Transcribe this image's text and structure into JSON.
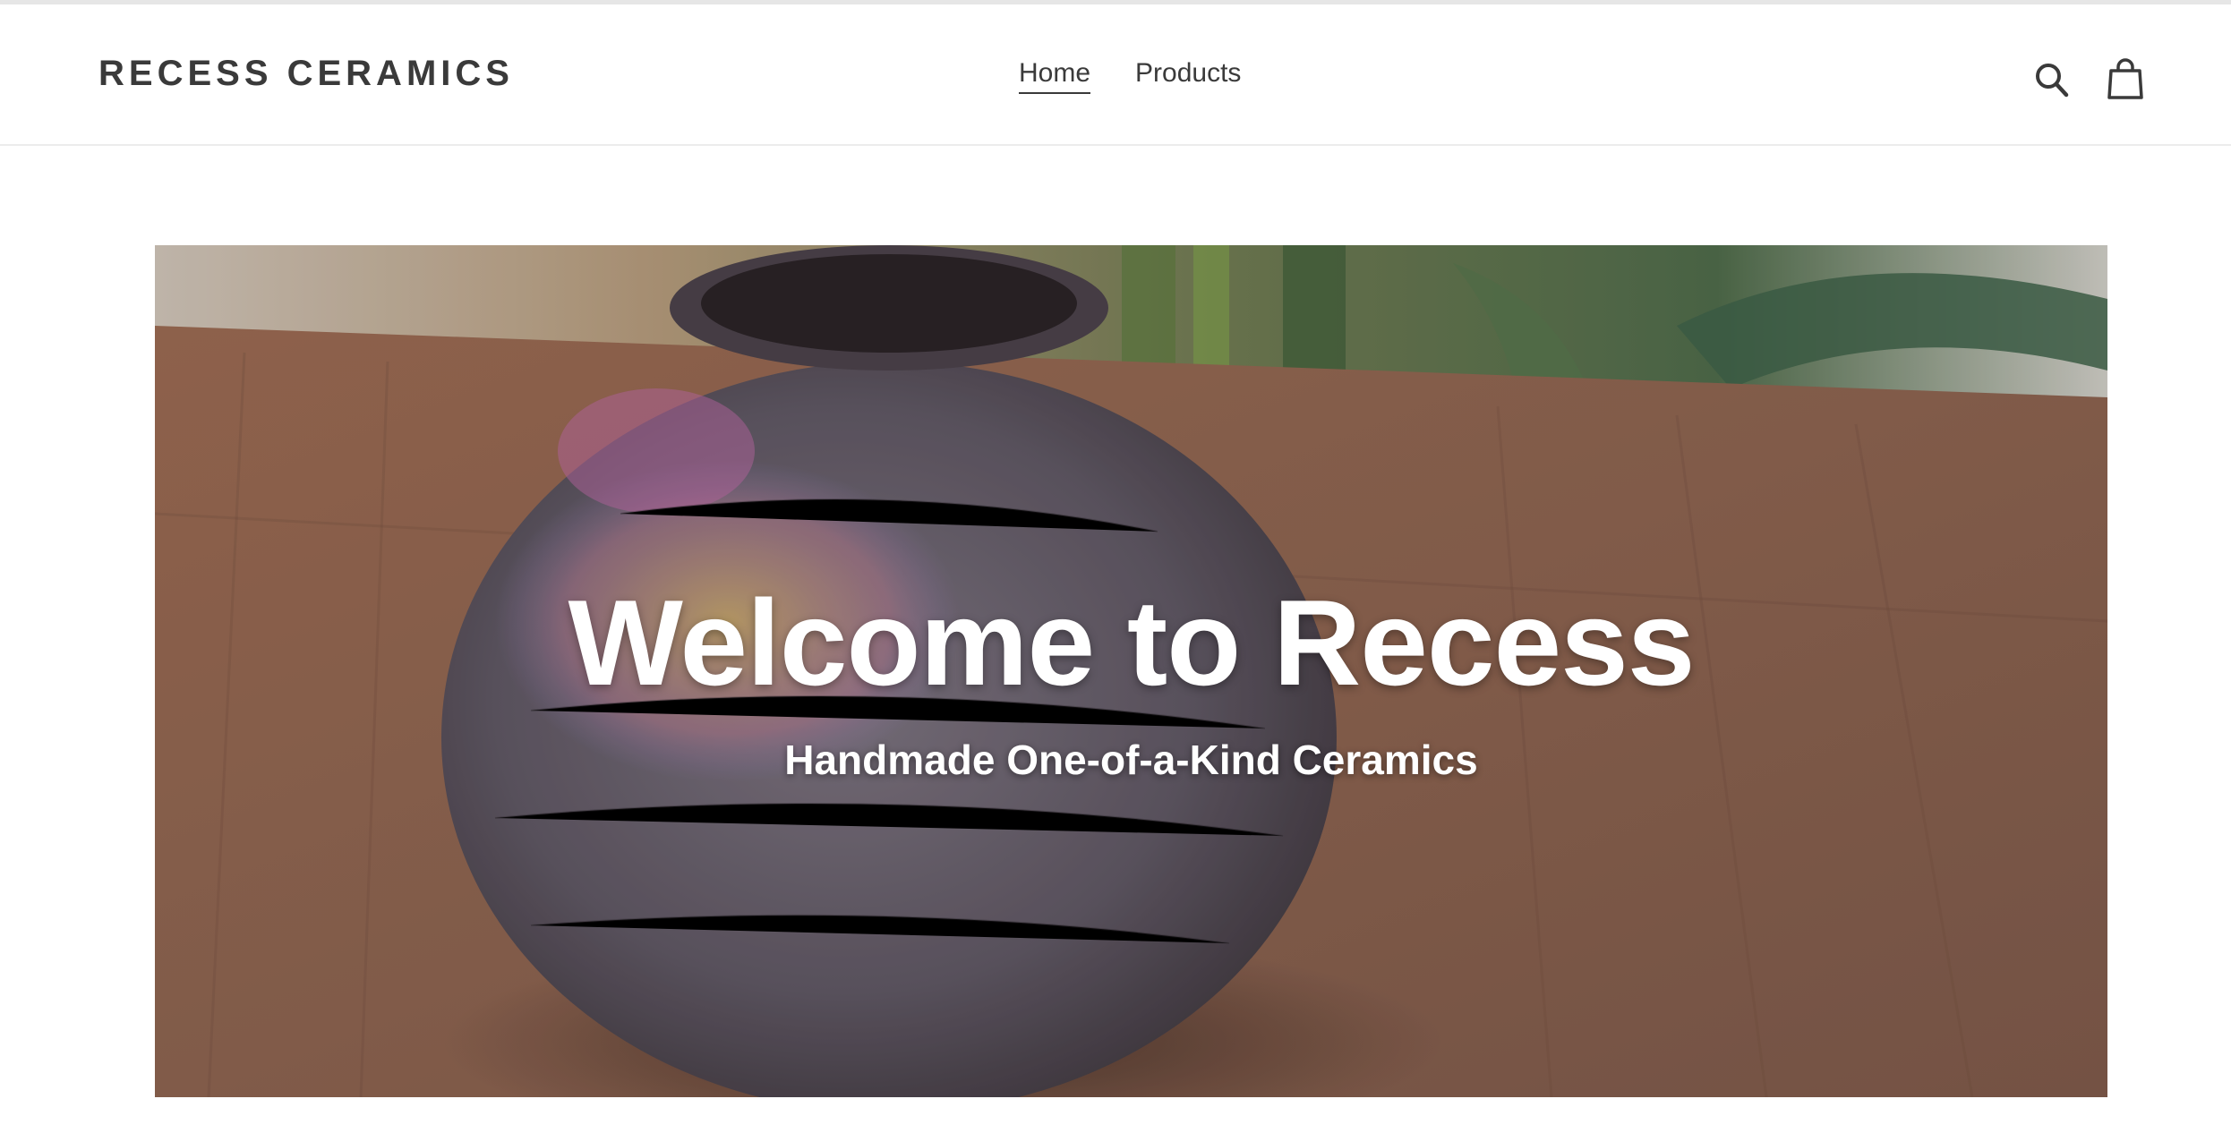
{
  "header": {
    "logo": "RECESS CERAMICS",
    "nav": [
      {
        "label": "Home",
        "active": true
      },
      {
        "label": "Products",
        "active": false
      }
    ],
    "icons": [
      "search-icon",
      "cart-icon"
    ]
  },
  "hero": {
    "title": "Welcome to Recess",
    "subtitle": "Handmade One-of-a-Kind Ceramics",
    "image": "photo of a round textured ceramic vase on a wooden table with plants in background"
  },
  "colors": {
    "text": "#3a3a3a",
    "header_border": "#ececec",
    "hero_text": "#ffffff"
  }
}
